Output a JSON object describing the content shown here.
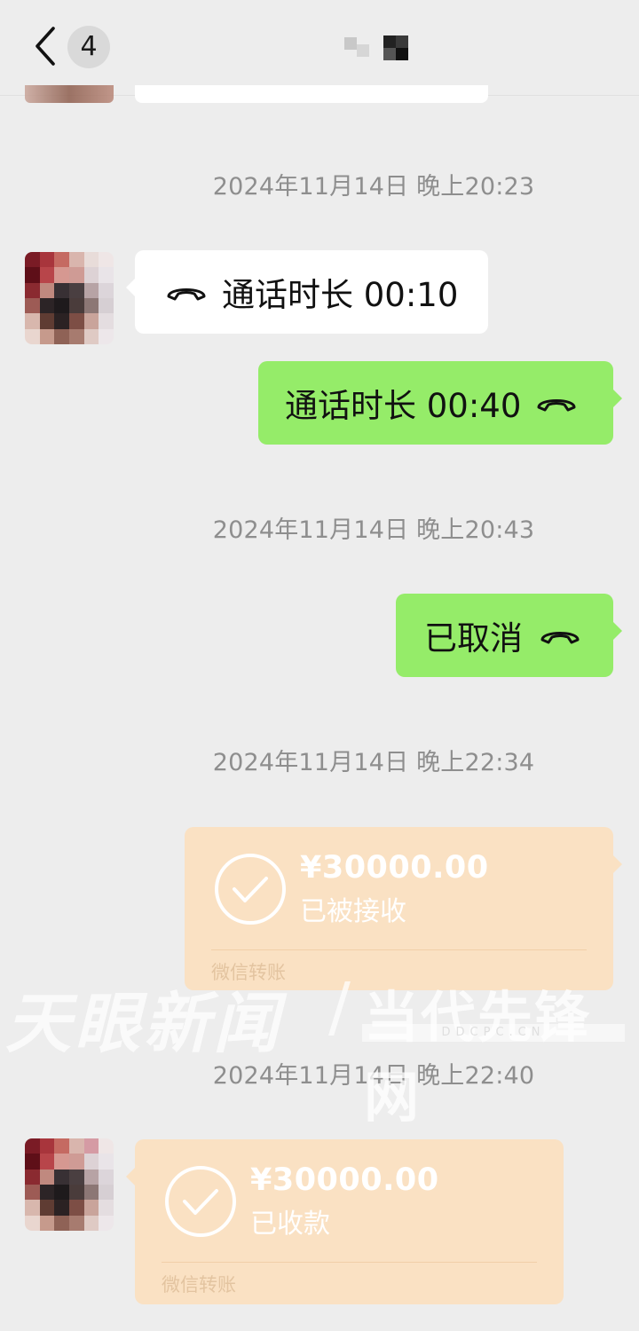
{
  "header": {
    "back_icon": "chevron-left-icon",
    "unread_count": "4",
    "contact_name": ""
  },
  "timestamps": [
    "2024年11月14日 晚上20:23",
    "2024年11月14日 晚上20:43",
    "2024年11月14日 晚上22:34",
    "2024年11月14日 晚上22:40"
  ],
  "messages": {
    "call_received": "通话时长 00:10",
    "call_sent": "通话时长 00:40",
    "call_cancelled": "已取消",
    "transfer_sent": {
      "amount": "¥30000.00",
      "status": "已被接收",
      "footer": "微信转账"
    },
    "transfer_received": {
      "amount": "¥30000.00",
      "status": "已收款",
      "footer": "微信转账"
    }
  },
  "icons": {
    "call": "phone-handset-icon",
    "transfer_done": "check-circle-icon"
  },
  "colors": {
    "background": "#ededed",
    "sent_bubble": "#95ec69",
    "received_bubble": "#ffffff",
    "transfer_card": "#fae1c3"
  },
  "watermark": {
    "left": "天眼新闻",
    "separator": "/",
    "right": "当代先锋网",
    "domain": "DDCPC.CN"
  }
}
